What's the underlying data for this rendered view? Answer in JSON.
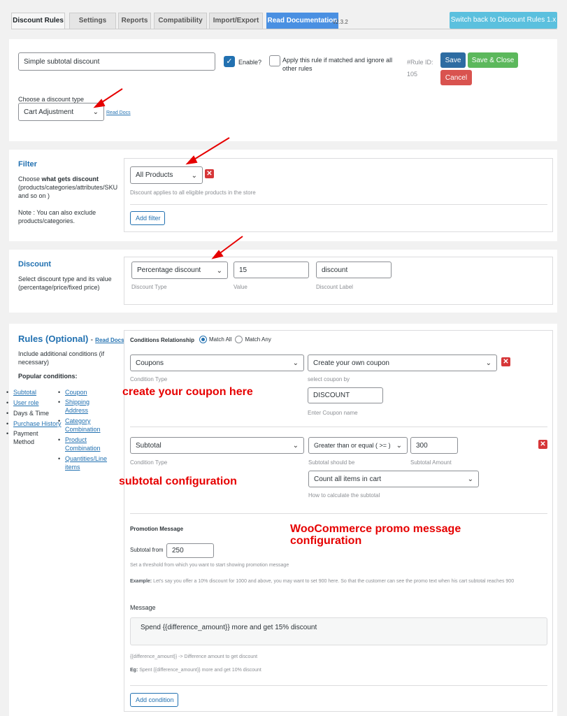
{
  "tabs": [
    {
      "label": "Discount Rules"
    },
    {
      "label": "Settings"
    },
    {
      "label": "Reports"
    },
    {
      "label": "Compatibility"
    },
    {
      "label": "Import/Export"
    },
    {
      "label": "Read Documentation"
    }
  ],
  "version": "v2.3.2",
  "switch_button": "Switch back to Discount Rules 1.x",
  "rule": {
    "name_value": "Simple subtotal discount",
    "enable_label": "Enable?",
    "apply_label": "Apply this rule if matched and ignore all other rules",
    "rule_id_label": "#Rule ID:",
    "rule_id": "105",
    "save": "Save",
    "save_close": "Save & Close",
    "cancel": "Cancel",
    "discount_type_label": "Choose a discount type",
    "discount_type_value": "Cart Adjustment",
    "read_docs": "Read Docs"
  },
  "filter": {
    "title": "Filter",
    "desc_prefix": "Choose ",
    "desc_bold": "what gets discount",
    "desc_rest": "(products/categories/attributes/SKU and so on )",
    "note": "Note : You can also exclude products/categories.",
    "select_value": "All Products",
    "hint": "Discount applies to all eligible products in the store",
    "add_filter": "Add filter"
  },
  "discount": {
    "title": "Discount",
    "desc": "Select discount type and its value (percentage/price/fixed price)",
    "type_value": "Percentage discount",
    "type_hint": "Discount Type",
    "value": "15",
    "value_hint": "Value",
    "label_value": "discount",
    "label_hint": "Discount Label"
  },
  "rules": {
    "title": "Rules (Optional)",
    "dash": " - ",
    "read_docs": "Read Docs",
    "desc": "Include additional conditions (if necessary)",
    "popular": "Popular conditions:",
    "col1": [
      "Subtotal",
      "User role",
      "Days & Time",
      "Purchase History",
      "Payment Method"
    ],
    "col2": [
      "Coupon",
      "Shipping Address",
      "Category Combination",
      "Product Combination",
      "Quantities/Line items"
    ],
    "relationship_label": "Conditions Relationship",
    "match_all": "Match All",
    "match_any": "Match Any",
    "cond1_type": "Coupons",
    "cond1_type_hint": "Condition Type",
    "cond1_coupon": "Create your own coupon",
    "cond1_coupon_hint": "select coupon by",
    "coupon_name": "DISCOUNT",
    "coupon_name_hint": "Enter Coupon name",
    "cond2_type": "Subtotal",
    "cond2_type_hint": "Condition Type",
    "cond2_operator": "Greater than or equal ( >= )",
    "cond2_operator_hint": "Subtotal should be",
    "cond2_amount": "300",
    "cond2_amount_hint": "Subtotal Amount",
    "calc_value": "Count all items in cart",
    "calc_hint": "How to calculate the subtotal",
    "promo_title": "Promotion Message",
    "subtotal_from_label": "Subtotal from",
    "subtotal_from_value": "250",
    "threshold_hint": "Set a threshold from which you want to start showing promotion message",
    "example_bold": "Example:",
    "example_text": " Let's say you offer a 10% discount for 1000 and above, you may want to set 900 here. So that the customer can see the promo text when his cart subtotal reaches 900",
    "message_label": "Message",
    "message_value": "Spend {{difference_amount}} more and get 15% discount",
    "diff_hint": "{{difference_amount}} -> Difference amount to get discount",
    "eg_bold": "Eg:",
    "eg_text": " Spent {{difference_amount}} more and get 10% discount",
    "add_condition": "Add condition"
  },
  "annotations": {
    "coupon": "create your coupon here",
    "subtotal": "subtotal configuration",
    "promo_line1": "WooCommerce promo message",
    "promo_line2": "configuration"
  },
  "colors": {
    "blue": "#2271b1",
    "save": "#2d6ca2",
    "save_close": "#5cb85c",
    "cancel": "#d9534f",
    "annotation_red": "#e60000"
  }
}
